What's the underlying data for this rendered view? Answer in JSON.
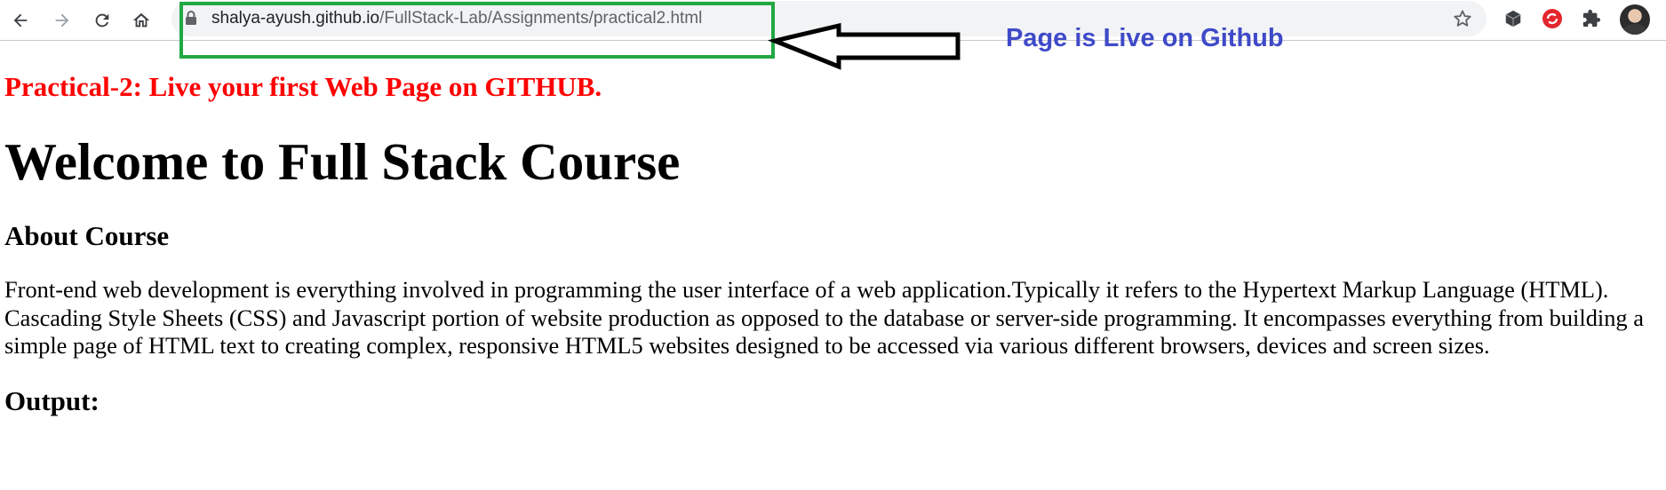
{
  "browser": {
    "url_host": "shalya-ayush.github.io",
    "url_path": "/FullStack-Lab/Assignments/practical2.html",
    "icons": [
      "back-arrow-icon",
      "forward-arrow-icon",
      "reload-icon",
      "home-icon",
      "lock-icon",
      "bookmark-star-icon",
      "extension-cube-icon",
      "extension-red-icon",
      "extensions-puzzle-icon",
      "profile-avatar"
    ]
  },
  "annotation": {
    "text": "Page is Live on Github",
    "box_color": "#20a843",
    "text_color": "#3f4ac8"
  },
  "page": {
    "practical_title": "Practical-2: Live your first Web Page on GITHUB.",
    "main_title": "Welcome to Full Stack Course",
    "about_heading": "About Course",
    "about_text": "Front-end web development is everything involved in programming the user interface of a web application.Typically it refers to the Hypertext Markup Language (HTML). Cascading Style Sheets (CSS) and Javascript portion of website production as opposed to the database or server-side programming. It encompasses everything from building a simple page of HTML text to creating complex, responsive HTML5 websites designed to be accessed via various different browsers, devices and screen sizes.",
    "output_heading": "Output:",
    "title_color": "#ff0000"
  }
}
